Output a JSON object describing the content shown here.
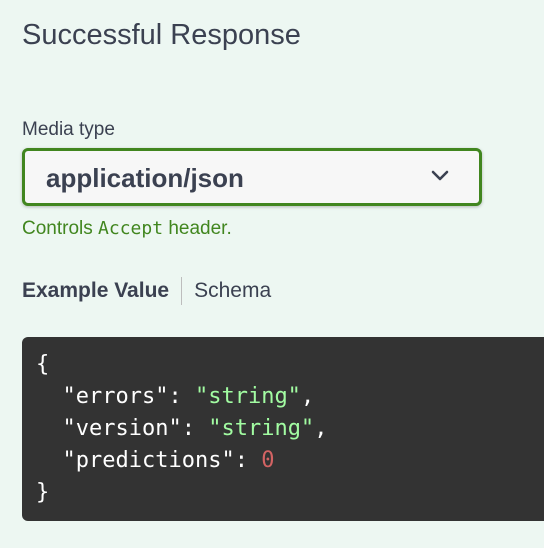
{
  "response": {
    "title": "Successful Response"
  },
  "media_type": {
    "label": "Media type",
    "selected": "application/json",
    "help_prefix": "Controls ",
    "help_code": "Accept",
    "help_suffix": " header."
  },
  "tabs": {
    "example_value": "Example Value",
    "schema": "Schema"
  },
  "example": {
    "open_brace": "{",
    "close_brace": "}",
    "fields": [
      {
        "key": "\"errors\"",
        "sep": ": ",
        "value": "\"string\"",
        "comma": ","
      },
      {
        "key": "\"version\"",
        "sep": ": ",
        "value": "\"string\"",
        "comma": ","
      },
      {
        "key": "\"predictions\"",
        "sep": ": ",
        "value": "0",
        "comma": ""
      }
    ]
  },
  "colors": {
    "accent_green": "#41861f",
    "code_background": "#333333",
    "string_green": "#a2fca2",
    "number_red": "#d36363"
  },
  "icons": {
    "select_chevron": "chevron-down-icon"
  }
}
